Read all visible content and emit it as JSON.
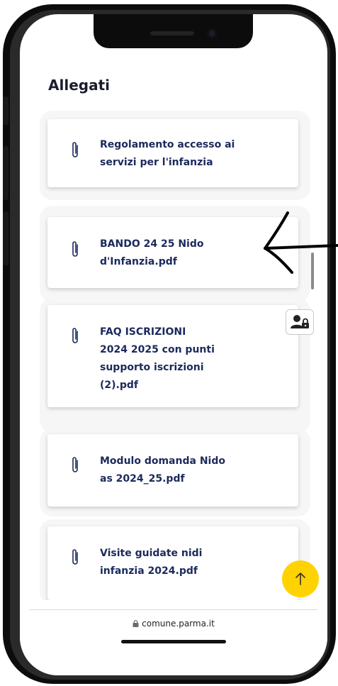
{
  "page": {
    "heading": "Allegati",
    "attachments": [
      {
        "label": "Regolamento accesso ai servizi per l'infanzia",
        "icon": "paperclip-icon"
      },
      {
        "label": "BANDO 24 25 Nido d'Infanzia.pdf",
        "icon": "paperclip-icon"
      },
      {
        "label": "FAQ ISCRIZIONI 2024 2025 con punti supporto iscrizioni (2).pdf",
        "icon": "paperclip-icon"
      },
      {
        "label": "Modulo domanda Nido as 2024_25.pdf",
        "icon": "paperclip-icon"
      },
      {
        "label": "Visite guidate nidi infanzia 2024.pdf",
        "icon": "paperclip-icon"
      }
    ]
  },
  "browser": {
    "url": "comune.parma.it",
    "lock_icon": "lock-icon"
  },
  "controls": {
    "back_to_top_icon": "arrow-up-icon",
    "accessibility_icon": "user-lock-icon"
  },
  "colors": {
    "text_dark": "#1b1d2e",
    "link_navy": "#1b2a5c",
    "fab_yellow": "#ffd301"
  }
}
